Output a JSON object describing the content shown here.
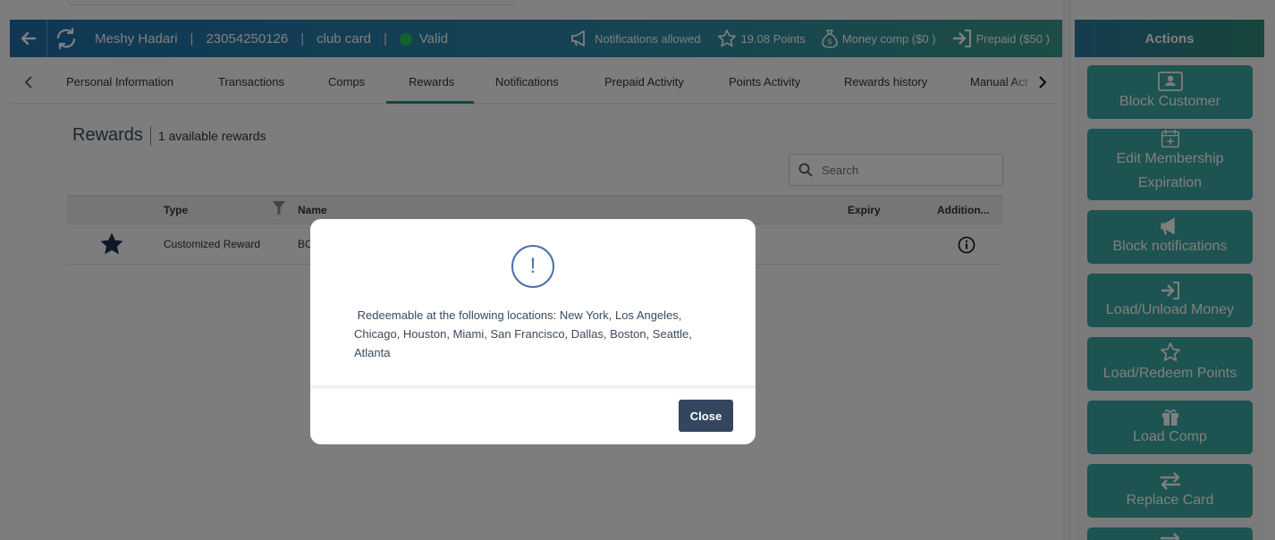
{
  "header": {
    "customer_name": "Meshy Hadari",
    "customer_id": "23054250126",
    "card_type": "club card",
    "status": "Valid",
    "notifications": "Notifications allowed",
    "points": "19.08 Points",
    "money_comp": "Money comp ($0 )",
    "prepaid": "Prepaid ($50 )",
    "separator": "|"
  },
  "tabs": [
    {
      "label": "Personal Information"
    },
    {
      "label": "Transactions"
    },
    {
      "label": "Comps"
    },
    {
      "label": "Rewards",
      "active": true
    },
    {
      "label": "Notifications"
    },
    {
      "label": "Prepaid Activity"
    },
    {
      "label": "Points Activity"
    },
    {
      "label": "Rewards history"
    },
    {
      "label": "Manual Act"
    }
  ],
  "rewards": {
    "title": "Rewards",
    "subtitle": "1 available rewards",
    "search_placeholder": "Search",
    "columns": {
      "type": "Type",
      "name": "Name",
      "expiry": "Expiry",
      "additional": "Addition..."
    },
    "rows": [
      {
        "type": "Customized Reward",
        "name": "BC",
        "expiry": ""
      }
    ]
  },
  "actions": {
    "title": "Actions",
    "buttons": [
      {
        "label": "Block Customer",
        "icon": "id-card-icon"
      },
      {
        "label": "Edit Membership Expiration",
        "icon": "calendar-plus-icon"
      },
      {
        "label": "Block notifications",
        "icon": "megaphone-icon"
      },
      {
        "label": "Load/Unload Money",
        "icon": "sign-in-icon"
      },
      {
        "label": "Load/Redeem Points",
        "icon": "star-icon"
      },
      {
        "label": "Load Comp",
        "icon": "gift-icon"
      },
      {
        "label": "Replace Card",
        "icon": "exchange-icon"
      }
    ]
  },
  "modal": {
    "icon": "!",
    "message": "Redeemable at the following locations: New York, Los Angeles, Chicago, Houston, Miami, San Francisco, Dallas, Boston, Seattle, Atlanta",
    "close_label": "Close"
  },
  "colors": {
    "header_start": "#1f6fa8",
    "header_end": "#3a9a8c",
    "action_button": "#3aa6a0",
    "tab_accent": "#2b8a8a",
    "close_button": "#34465f",
    "valid_dot": "#22c55e"
  }
}
